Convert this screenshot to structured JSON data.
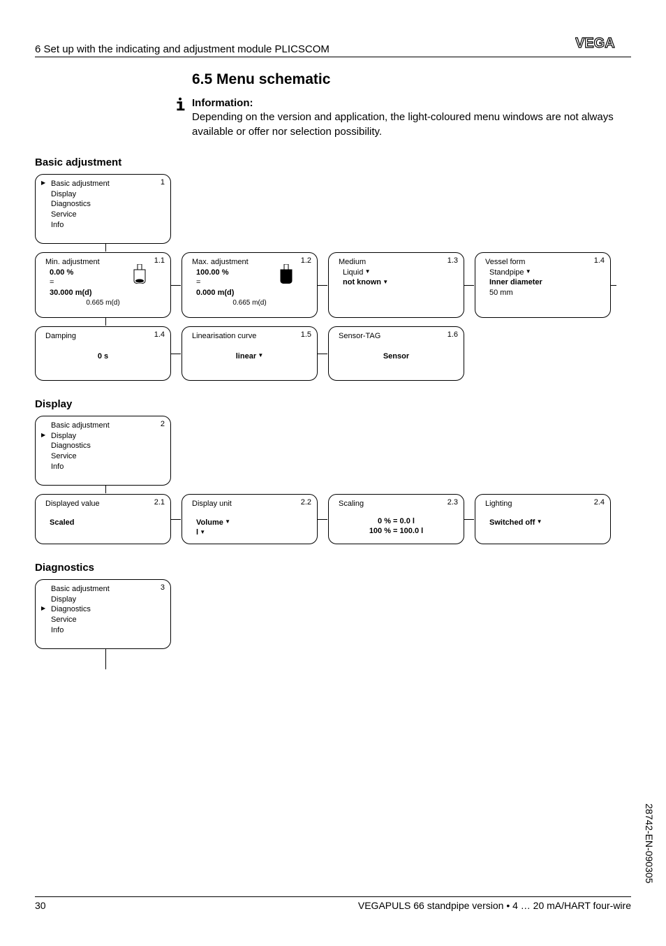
{
  "header": {
    "chapter": "6  Set up with the indicating and adjustment module PLICSCOM"
  },
  "section": {
    "title": "6.5   Menu schematic"
  },
  "note": {
    "label": "Information:",
    "text": "Depending on the version and application, the light-coloured menu windows are not always available or offer nor selection possibility."
  },
  "blocks": {
    "basic": {
      "heading": "Basic adjustment",
      "menu": {
        "num": "1",
        "items": [
          "Basic adjustment",
          "Display",
          "Diagnostics",
          "Service",
          "Info"
        ],
        "selected": 0
      },
      "row1": {
        "min": {
          "num": "1.1",
          "title": "Min. adjustment",
          "percent": "0.00 %",
          "eq": "=",
          "dist": "30.000 m(d)",
          "sub": "0.665 m(d)"
        },
        "max": {
          "num": "1.2",
          "title": "Max. adjustment",
          "percent": "100.00 %",
          "eq": "=",
          "dist": "0.000 m(d)",
          "sub": "0.665 m(d)"
        },
        "medium": {
          "num": "1.3",
          "title": "Medium",
          "v1": "Liquid",
          "v2": "not known"
        },
        "vessel": {
          "num": "1.4",
          "title": "Vessel form",
          "v1": "Standpipe",
          "param": "Inner diameter",
          "v2": "50 mm"
        }
      },
      "row2": {
        "damping": {
          "num": "1.4",
          "title": "Damping",
          "value": "0 s"
        },
        "linear": {
          "num": "1.5",
          "title": "Linearisation curve",
          "value": "linear"
        },
        "tag": {
          "num": "1.6",
          "title": "Sensor-TAG",
          "value": "Sensor"
        }
      }
    },
    "display": {
      "heading": "Display",
      "menu": {
        "num": "2",
        "items": [
          "Basic adjustment",
          "Display",
          "Diagnostics",
          "Service",
          "Info"
        ],
        "selected": 1
      },
      "row": {
        "dv": {
          "num": "2.1",
          "title": "Displayed value",
          "value": "Scaled"
        },
        "unit": {
          "num": "2.2",
          "title": "Display unit",
          "v1": "Volume",
          "v2": "l"
        },
        "scaling": {
          "num": "2.3",
          "title": "Scaling",
          "l1": "0 % = 0.0 l",
          "l2": "100 % = 100.0 l"
        },
        "light": {
          "num": "2.4",
          "title": "Lighting",
          "value": "Switched off"
        }
      }
    },
    "diag": {
      "heading": "Diagnostics",
      "menu": {
        "num": "3",
        "items": [
          "Basic adjustment",
          "Display",
          "Diagnostics",
          "Service",
          "Info"
        ],
        "selected": 2
      }
    }
  },
  "footer": {
    "page": "30",
    "product": "VEGAPULS 66 standpipe version • 4 … 20 mA/HART four-wire"
  },
  "side": "28742-EN-090305"
}
